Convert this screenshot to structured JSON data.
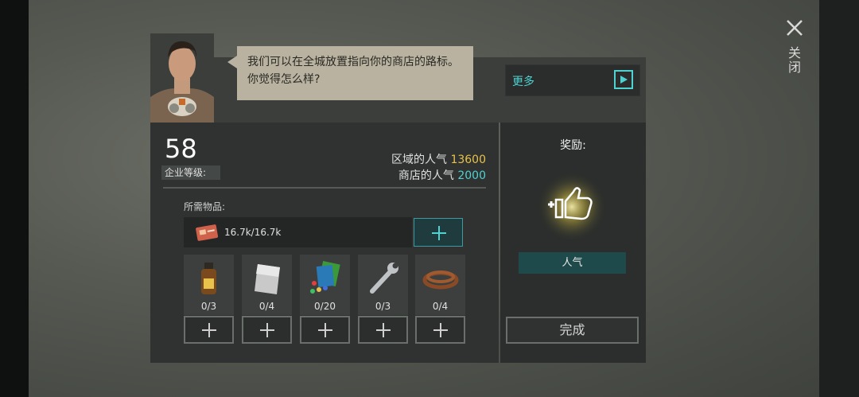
{
  "close": {
    "label": "关闭"
  },
  "dialog": {
    "text": "我们可以在全城放置指向你的商店的路标。你觉得怎么样?"
  },
  "more": {
    "label": "更多"
  },
  "company": {
    "level": "58",
    "level_label": "企业等级:"
  },
  "popularity": {
    "district_label": "区域的人气",
    "district_value": "13600",
    "shop_label": "商店的人气",
    "shop_value": "2000"
  },
  "required": {
    "label": "所需物品:",
    "card_amount": "16.7k/16.7k",
    "items": [
      {
        "name": "bottle-icon",
        "count": "0/3"
      },
      {
        "name": "metal-plate-icon",
        "count": "0/4"
      },
      {
        "name": "electronics-icon",
        "count": "0/20"
      },
      {
        "name": "wrench-icon",
        "count": "0/3"
      },
      {
        "name": "belt-icon",
        "count": "0/4"
      }
    ]
  },
  "reward": {
    "title": "奖励:",
    "tag": "人气",
    "done": "完成"
  },
  "colors": {
    "accent": "#4fd2d2",
    "gold": "#e8c24a",
    "bubble": "#b9b2a0"
  }
}
